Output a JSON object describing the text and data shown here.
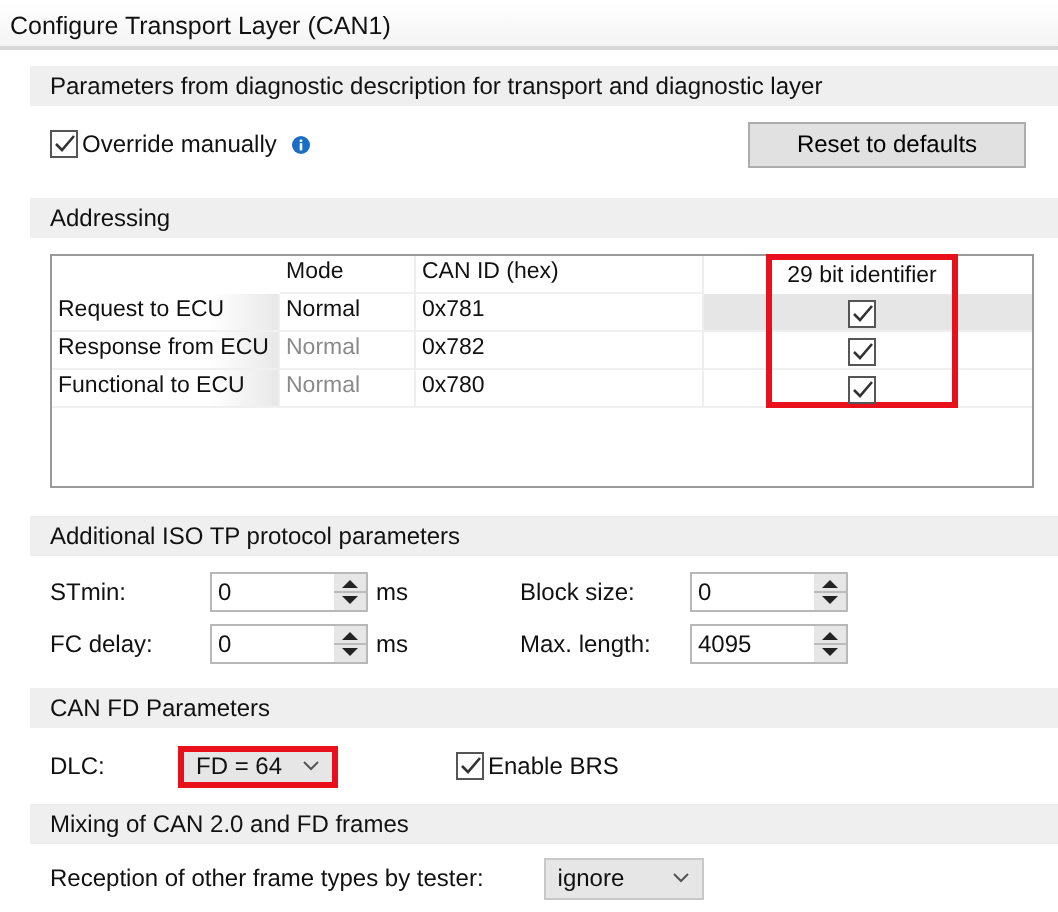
{
  "window": {
    "title": "Configure Transport Layer (CAN1)"
  },
  "diagnostic_section": {
    "header": "Parameters from diagnostic description for transport and diagnostic layer",
    "override": {
      "label": "Override manually",
      "checked": true
    },
    "reset_button": "Reset to defaults"
  },
  "addressing": {
    "header": "Addressing",
    "columns": [
      "Mode",
      "CAN ID (hex)",
      "29 bit identifier"
    ],
    "identifier_column_highlighted": true,
    "rows": [
      {
        "label": "Request to ECU",
        "mode": "Normal",
        "mode_disabled": false,
        "can_id": "0x781",
        "extended": true,
        "selected": true
      },
      {
        "label": "Response from ECU",
        "mode": "Normal",
        "mode_disabled": true,
        "can_id": "0x782",
        "extended": true,
        "selected": false
      },
      {
        "label": "Functional to ECU",
        "mode": "Normal",
        "mode_disabled": true,
        "can_id": "0x780",
        "extended": true,
        "selected": false
      }
    ]
  },
  "iso_tp": {
    "header": "Additional ISO TP protocol parameters",
    "fields": [
      {
        "label": "STmin:",
        "value": "0",
        "unit": "ms"
      },
      {
        "label": "Block size:",
        "value": "0"
      },
      {
        "label": "FC delay:",
        "value": "0",
        "unit": "ms"
      },
      {
        "label": "Max. length:",
        "value": "4095"
      }
    ]
  },
  "can_fd": {
    "header": "CAN FD Parameters",
    "dlc": {
      "label": "DLC:",
      "value": "FD = 64",
      "highlighted": true
    },
    "brs": {
      "label": "Enable BRS",
      "checked": true
    }
  },
  "mixing": {
    "header": "Mixing of CAN 2.0 and FD frames",
    "reception": {
      "label": "Reception of other frame types by tester:",
      "value": "ignore"
    }
  }
}
